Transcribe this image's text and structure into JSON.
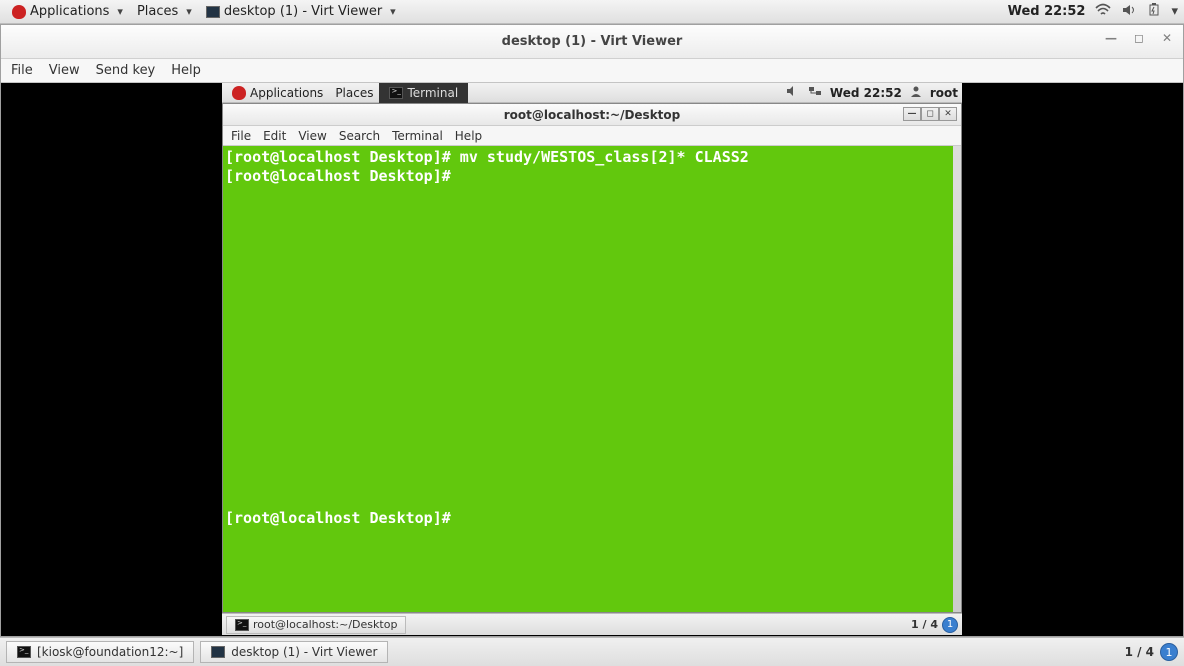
{
  "host": {
    "topbar": {
      "applications": "Applications",
      "places": "Places",
      "running_app": "desktop (1) - Virt Viewer",
      "datetime": "Wed 22:52"
    },
    "bottombar": {
      "task1": "[kiosk@foundation12:~]",
      "task2": "desktop (1) - Virt Viewer",
      "workspace": "1 / 4",
      "ws_badge": "1"
    }
  },
  "virt": {
    "title": "desktop (1) - Virt Viewer",
    "menu": {
      "file": "File",
      "view": "View",
      "sendkey": "Send key",
      "help": "Help"
    }
  },
  "guest": {
    "topbar": {
      "applications": "Applications",
      "places": "Places",
      "active_tab": "Terminal",
      "datetime": "Wed 22:52",
      "user": "root"
    },
    "bottombar": {
      "task1": "root@localhost:~/Desktop",
      "workspace": "1 / 4",
      "ws_badge": "1"
    }
  },
  "terminal": {
    "title": "root@localhost:~/Desktop",
    "menu": {
      "file": "File",
      "edit": "Edit",
      "view": "View",
      "search": "Search",
      "terminal": "Terminal",
      "help": "Help"
    },
    "lines": {
      "l0": "[root@localhost Desktop]# mv study/WESTOS_class[2]* CLASS2",
      "l1": "[root@localhost Desktop]# ",
      "bottom": "[root@localhost Desktop]# "
    }
  }
}
